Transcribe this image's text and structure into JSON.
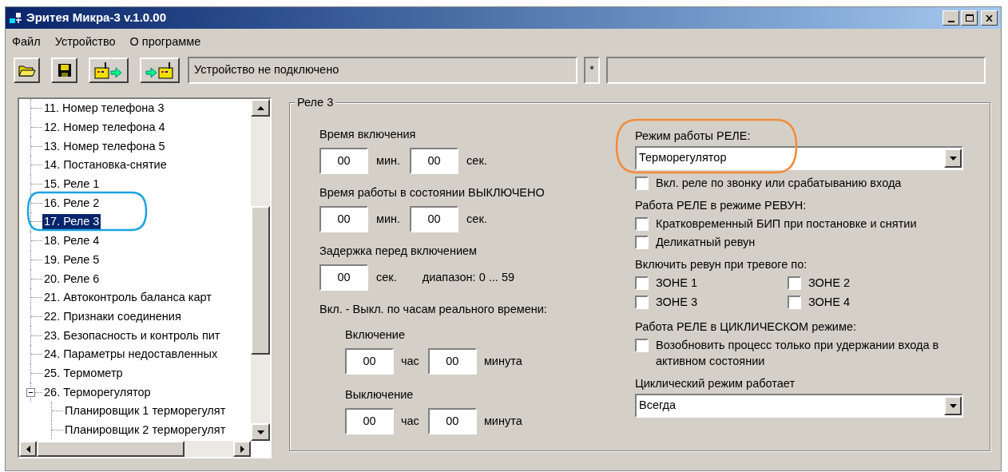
{
  "window": {
    "title": "Эритея Микра-3 v.1.0.00"
  },
  "menu": [
    "Файл",
    "Устройство",
    "О программе"
  ],
  "toolbar": {
    "status": "Устройство не подключено",
    "marker": "*"
  },
  "tree": {
    "items": [
      {
        "label": "11. Номер телефона 3",
        "selected": false
      },
      {
        "label": "12. Номер телефона 4",
        "selected": false
      },
      {
        "label": "13. Номер телефона 5",
        "selected": false
      },
      {
        "label": "14. Постановка-снятие",
        "selected": false
      },
      {
        "label": "15. Реле 1",
        "selected": false
      },
      {
        "label": "16. Реле 2",
        "selected": false
      },
      {
        "label": "17. Реле 3",
        "selected": true
      },
      {
        "label": "18. Реле 4",
        "selected": false
      },
      {
        "label": "19. Реле 5",
        "selected": false
      },
      {
        "label": "20. Реле 6",
        "selected": false
      },
      {
        "label": "21. Автоконтроль баланса карт",
        "selected": false
      },
      {
        "label": "22. Признаки соединения",
        "selected": false
      },
      {
        "label": "23. Безопасность и контроль пит",
        "selected": false
      },
      {
        "label": "24. Параметры недоставленных",
        "selected": false
      },
      {
        "label": "25. Термометр",
        "selected": false
      },
      {
        "label": "26. Терморегулятор",
        "selected": false,
        "expanded": true,
        "children": [
          {
            "label": "Планировщик 1 терморегулят",
            "selected": false
          },
          {
            "label": "Планировщик 2 терморегулят",
            "selected": false
          }
        ]
      }
    ]
  },
  "panel": {
    "title": "Реле 3",
    "left": [
      {
        "kind": "heading",
        "text": "Время включения"
      },
      {
        "kind": "fields",
        "items": [
          {
            "value": "00",
            "unit": "мин."
          },
          {
            "value": "00",
            "unit": "сек."
          }
        ]
      },
      {
        "kind": "heading",
        "text": "Время работы в состоянии ВЫКЛЮЧЕНО"
      },
      {
        "kind": "fields",
        "items": [
          {
            "value": "00",
            "unit": "мин."
          },
          {
            "value": "00",
            "unit": "сек."
          }
        ]
      },
      {
        "kind": "heading",
        "text": "Задержка перед включением"
      },
      {
        "kind": "fields",
        "items": [
          {
            "value": "00",
            "unit": "сек."
          }
        ],
        "note": "диапазон: 0 ... 59"
      },
      {
        "kind": "heading",
        "text": "Вкл. - Выкл. по часам реального времени:"
      },
      {
        "kind": "subheading",
        "text": "Включение"
      },
      {
        "kind": "subfields",
        "items": [
          {
            "value": "00",
            "unit": "час"
          },
          {
            "value": "00",
            "unit": "минута"
          }
        ]
      },
      {
        "kind": "subheading",
        "text": "Выключение"
      },
      {
        "kind": "subfields",
        "items": [
          {
            "value": "00",
            "unit": "час"
          },
          {
            "value": "00",
            "unit": "минута"
          }
        ]
      }
    ],
    "right": [
      {
        "kind": "heading",
        "text": "Режим работы РЕЛЕ:"
      },
      {
        "kind": "select",
        "value": "Терморегулятор"
      },
      {
        "kind": "checkbox",
        "label": "Вкл. реле по звонку или срабатыванию входа",
        "checked": false
      },
      {
        "kind": "heading",
        "text": "Работа РЕЛЕ в режиме РЕВУН:"
      },
      {
        "kind": "checkbox",
        "label": "Кратковременный БИП при постановке и снятии",
        "checked": false
      },
      {
        "kind": "checkbox",
        "label": "Деликатный ревун",
        "checked": false
      },
      {
        "kind": "heading",
        "text": "Включить ревун при тревоге по:"
      },
      {
        "kind": "grid",
        "items": [
          {
            "label": "ЗОНЕ 1",
            "checked": false
          },
          {
            "label": "ЗОНЕ 2",
            "checked": false
          },
          {
            "label": "ЗОНЕ 3",
            "checked": false
          },
          {
            "label": "ЗОНЕ 4",
            "checked": false
          }
        ]
      },
      {
        "kind": "heading",
        "text": "Работа РЕЛЕ в ЦИКЛИЧЕСКОМ режиме:"
      },
      {
        "kind": "checkbox",
        "label": "Возобновить процесс только при удержании входа в активном состоянии",
        "checked": false
      },
      {
        "kind": "heading",
        "text": "Циклический режим работает"
      },
      {
        "kind": "select",
        "value": "Всегда"
      }
    ]
  },
  "annotations": [
    {
      "kind": "ellipse",
      "color": "#1aa3e0"
    },
    {
      "kind": "ellipse",
      "color": "#f28b3a"
    }
  ]
}
